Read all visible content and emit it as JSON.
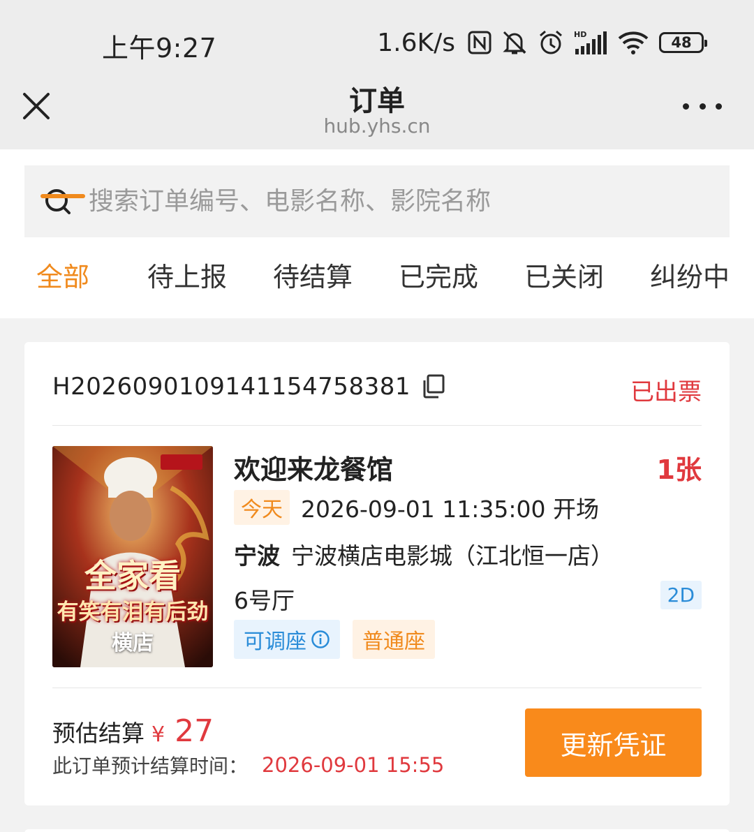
{
  "status_bar": {
    "time": "上午9:27",
    "net_speed": "1.6K/s",
    "battery": "48",
    "icons": [
      "nfc-icon",
      "mute-icon",
      "alarm-icon",
      "hd-signal-icon",
      "wifi-icon",
      "battery-icon"
    ]
  },
  "nav": {
    "title": "订单",
    "subtitle": "hub.yhs.cn"
  },
  "search": {
    "placeholder": "搜索订单编号、电影名称、影院名称"
  },
  "tabs": [
    {
      "label": "全部",
      "active": true
    },
    {
      "label": "待上报",
      "active": false
    },
    {
      "label": "待结算",
      "active": false
    },
    {
      "label": "已完成",
      "active": false
    },
    {
      "label": "已关闭",
      "active": false
    },
    {
      "label": "纠纷中",
      "active": false
    }
  ],
  "order": {
    "order_no": "H20260901091411547583​81",
    "status": "已出票",
    "poster": {
      "slogan_line1": "全家看",
      "slogan_line2": "有笑有泪有后劲",
      "caption": "横店"
    },
    "movie_title": "欢迎来龙餐馆",
    "ticket_count": "1张",
    "today_badge": "今天",
    "show_time": "2026-09-01 11:35:00 开场",
    "city": "宁波",
    "cinema": "宁波横店电影城（江北恒一店）",
    "hall": "6号厅",
    "format": "2D",
    "tag_adjustable": "可调座",
    "tag_seat_type": "普通座",
    "settle_label": "预估结算",
    "currency": "¥",
    "settle_amount": "27",
    "settle_time_label": "此订单预计结算时间：",
    "settle_time": "2026-09-01 15:55",
    "action_button": "更新凭证"
  },
  "colors": {
    "accent": "#f08a1d",
    "button": "#f98a1b",
    "alert_red": "#e0393e",
    "info_blue": "#2a8cd8"
  }
}
